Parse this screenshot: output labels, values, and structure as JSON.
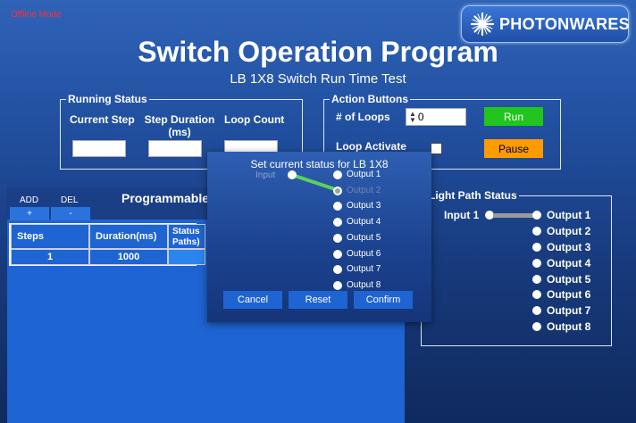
{
  "header": {
    "offline_mode": "Offline Mode",
    "logo_text": "PHOTONWARES",
    "title": "Switch Operation Program",
    "subtitle": "LB 1X8 Switch Run Time Test"
  },
  "running_status": {
    "legend": "Running Status",
    "current_step_label": "Current Step",
    "step_duration_label": "Step Duration\n(ms)",
    "loop_count_label": "Loop Count",
    "current_step_value": "",
    "step_duration_value": "",
    "loop_count_value": ""
  },
  "action_buttons": {
    "legend": "Action Buttons",
    "loops_label": "# of Loops",
    "loops_value": "0",
    "run_label": "Run",
    "loop_activate_label": "Loop Activate",
    "pause_label": "Pause",
    "run_color": "#22c41e",
    "pause_color": "#ff9a00"
  },
  "programmable": {
    "add_label": "ADD",
    "del_label": "DEL",
    "add_symbol": "+",
    "del_symbol": "-",
    "title": "Programmable",
    "table": {
      "headers": [
        "Steps",
        "Duration(ms)",
        "Status\nPaths)"
      ],
      "rows": [
        {
          "step": "1",
          "duration": "1000",
          "status": ""
        }
      ]
    }
  },
  "light_path": {
    "legend": "Light Path Status",
    "input_label": "Input 1",
    "outputs": [
      "Output 1",
      "Output 2",
      "Output 3",
      "Output 4",
      "Output 5",
      "Output 6",
      "Output 7",
      "Output 8"
    ],
    "connected_output": 1
  },
  "dialog": {
    "title": "Set current status for LB 1X8",
    "input_label": "Input",
    "outputs": [
      "Output 1",
      "Output 2",
      "Output 3",
      "Output 4",
      "Output 5",
      "Output 6",
      "Output 7",
      "Output 8"
    ],
    "connected_output": 2,
    "cancel_label": "Cancel",
    "reset_label": "Reset",
    "confirm_label": "Confirm"
  }
}
